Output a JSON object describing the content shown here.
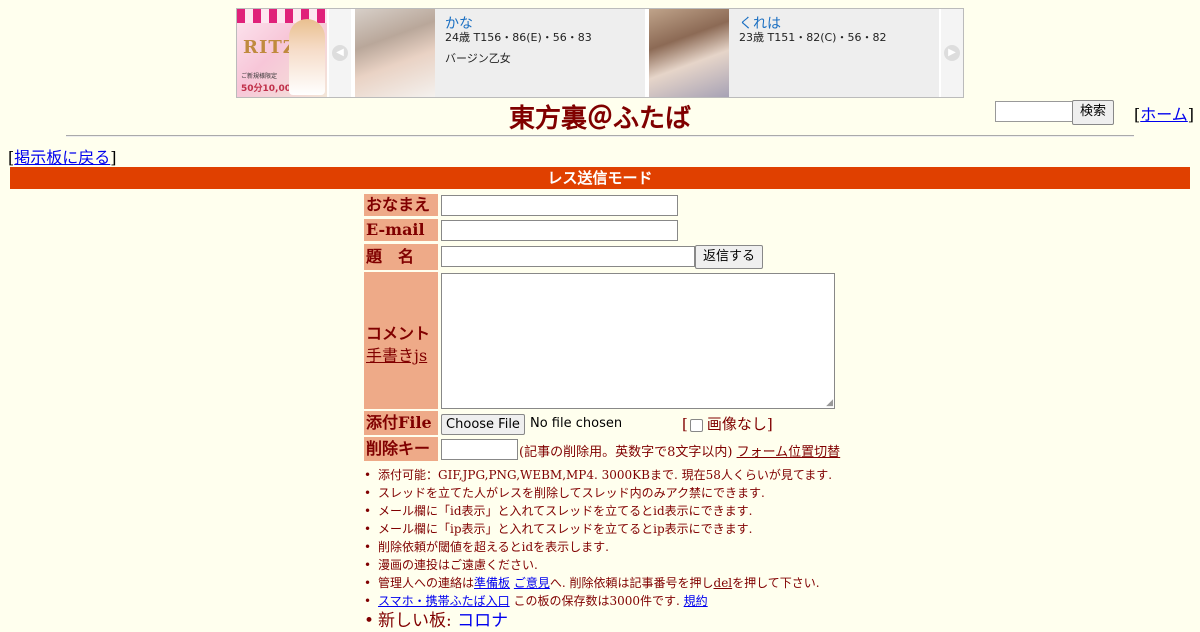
{
  "ad": {
    "promo": {
      "logo": "RITZ",
      "band": "IKEBUKURO ROYAL HEALTH",
      "tag": "ご新規様限定",
      "price": "50分10,000円"
    },
    "cards": [
      {
        "name": "かな",
        "spec": "24歳 T156・86(E)・56・83",
        "catch": "バージン乙女"
      },
      {
        "name": "くれは",
        "spec": "23歳 T151・82(C)・56・82",
        "catch": ""
      }
    ]
  },
  "header": {
    "title": "東方裏＠ふたば",
    "search_button": "検索",
    "home_label": "ホーム",
    "back_label": "掲示板に戻る"
  },
  "mode_bar": "レス送信モード",
  "form": {
    "name_label": "おなまえ",
    "email_label": "E-mail",
    "subject_label": "題　名",
    "submit_label": "返信する",
    "comment_label": "コメント",
    "tegaki_label": "手書きjs",
    "file_label": "添付File",
    "file_button": "Choose File",
    "file_status": "No file chosen",
    "no_image_label": "画像なし",
    "delkey_label": "削除キー",
    "delkey_note": "(記事の削除用。英数字で8文字以内)",
    "form_toggle": "フォーム位置切替"
  },
  "rules": {
    "r1": "添付可能：GIF,JPG,PNG,WEBM,MP4. 3000KBまで. 現在58人くらいが見てます.",
    "r2": "スレッドを立てた人がレスを削除してスレッド内のみアク禁にできます.",
    "r3": "メール欄に「id表示」と入れてスレッドを立てるとid表示にできます.",
    "r4": "メール欄に「ip表示」と入れてスレッドを立てるとip表示にできます.",
    "r5": "削除依頼が閾値を超えるとidを表示します.",
    "r6": "漫画の連投はご遠慮ください.",
    "r7_pre": "管理人への連絡は",
    "r7_link1": "準備板",
    "r7_link2": "ご意見",
    "r7_mid": "へ. 削除依頼は記事番号を押し",
    "r7_del": "del",
    "r7_post": "を押して下さい.",
    "r8_link": "スマホ・携帯ふたば入口",
    "r8_mid": " この板の保存数は3000件です. ",
    "r8_link2": "規約",
    "r9_pre": "新しい板: ",
    "r9_link": "コロナ"
  },
  "colors": {
    "background": "#ffffee",
    "text": "#800000",
    "mode_bar": "#e04000",
    "label_bg": "#eeaa88",
    "link": "#0000ee"
  }
}
